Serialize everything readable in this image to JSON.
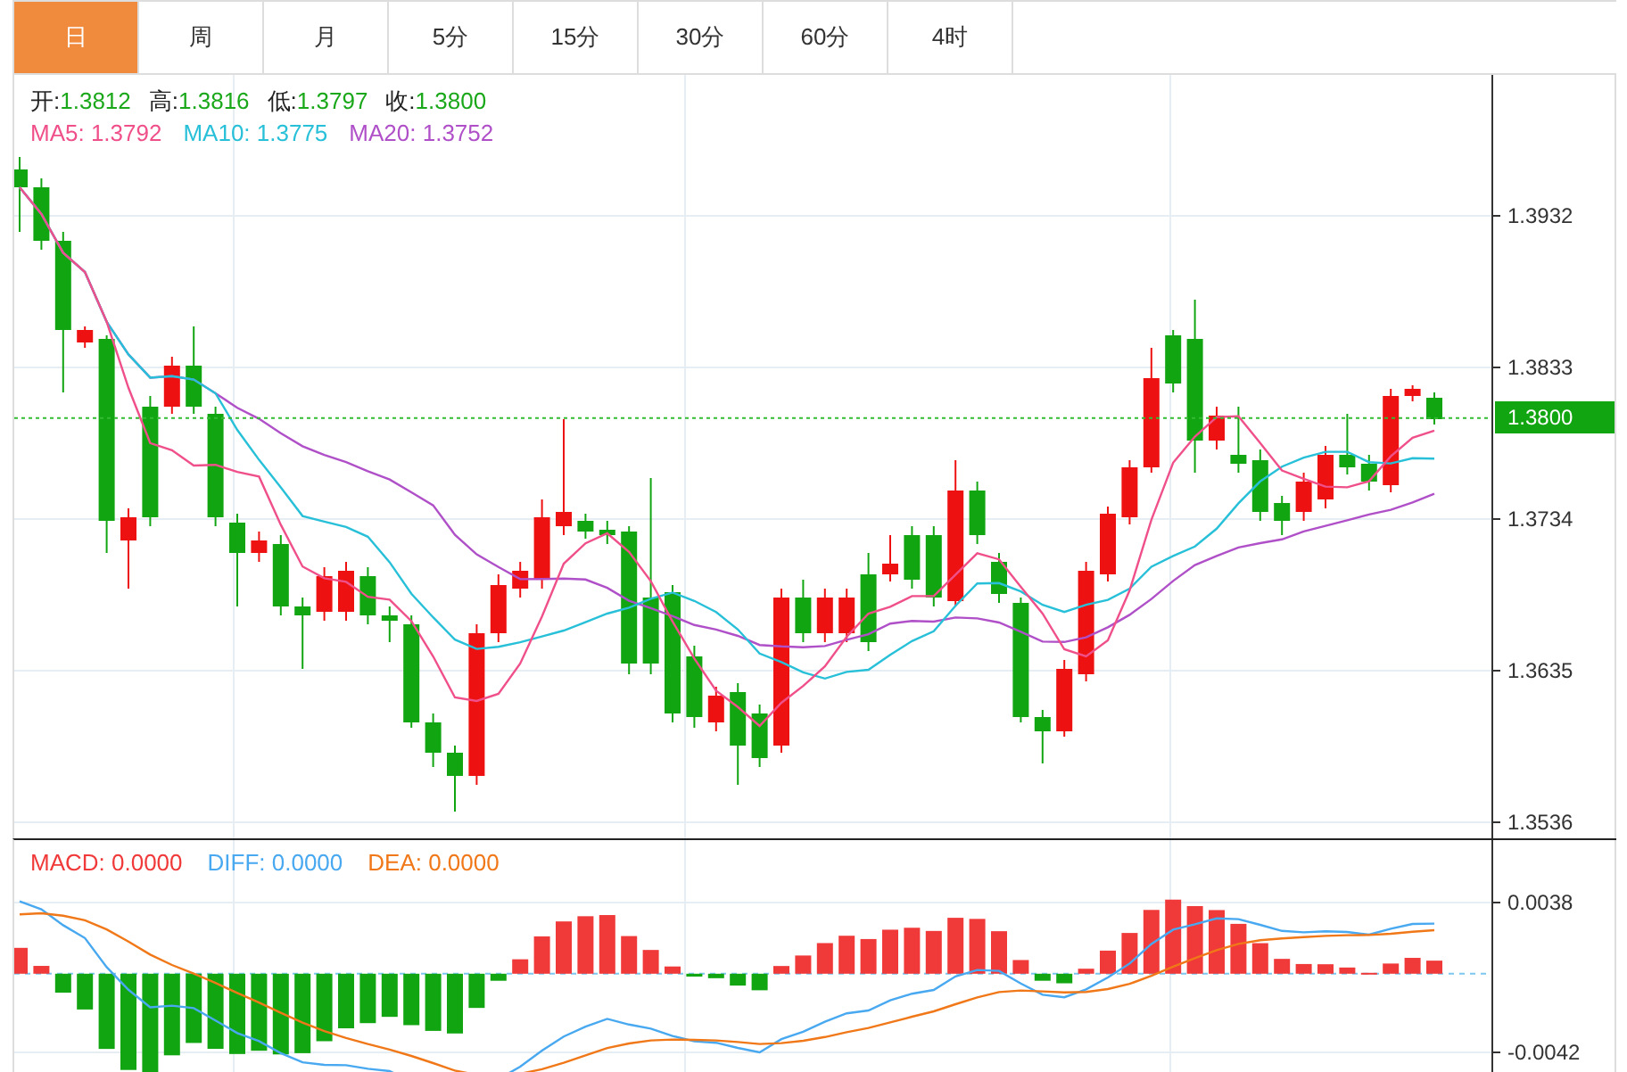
{
  "tabs": [
    {
      "label": "日",
      "selected": true
    },
    {
      "label": "周",
      "selected": false
    },
    {
      "label": "月",
      "selected": false
    },
    {
      "label": "5分",
      "selected": false
    },
    {
      "label": "15分",
      "selected": false
    },
    {
      "label": "30分",
      "selected": false
    },
    {
      "label": "60分",
      "selected": false
    },
    {
      "label": "4时",
      "selected": false
    }
  ],
  "ohlc_legend": [
    {
      "label": "开:",
      "value": "1.3812"
    },
    {
      "label": "高:",
      "value": "1.3816"
    },
    {
      "label": "低:",
      "value": "1.3797"
    },
    {
      "label": "收:",
      "value": "1.3800"
    }
  ],
  "ma_legend": [
    {
      "text": "MA5: 1.3792",
      "color": "#f0508a"
    },
    {
      "text": "MA10: 1.3775",
      "color": "#28c0d8"
    },
    {
      "text": "MA20: 1.3752",
      "color": "#b050c8"
    }
  ],
  "price_axis": {
    "ticks": [
      "1.3932",
      "1.3833",
      "1.3734",
      "1.3635",
      "1.3536"
    ],
    "current_price": "1.3800"
  },
  "macd_legend": [
    {
      "text": "MACD: 0.0000",
      "color": "#f03a3a"
    },
    {
      "text": "DIFF: 0.0000",
      "color": "#48a8f0"
    },
    {
      "text": "DEA: 0.0000",
      "color": "#f07818"
    }
  ],
  "macd_axis": {
    "ticks": [
      "0.0038",
      "-0.0042"
    ]
  }
}
